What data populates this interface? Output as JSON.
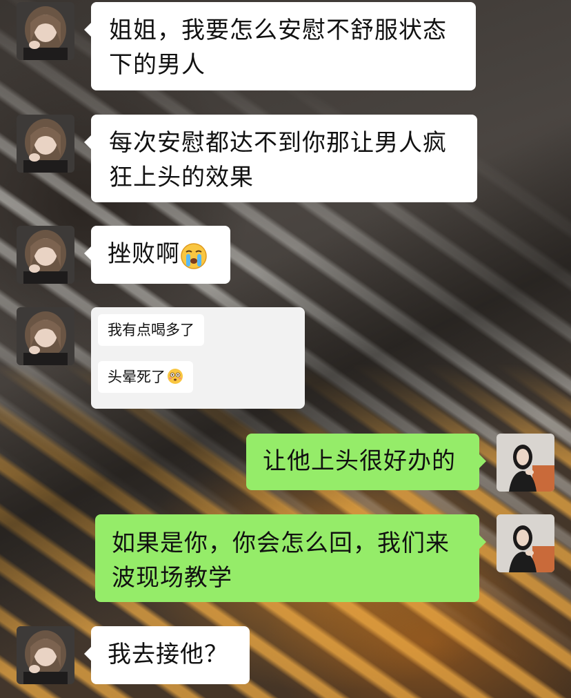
{
  "messages": [
    {
      "side": "left",
      "text": "姐姐，我要怎么安慰不舒服状态\n下的男人"
    },
    {
      "side": "left",
      "text": "每次安慰都达不到你那让男人疯\n狂上头的效果"
    },
    {
      "side": "left",
      "text": "挫败啊",
      "emoji": "crying-face-emoji"
    },
    {
      "side": "left",
      "quoted": [
        "我有点喝多了",
        "头晕死了"
      ],
      "emoji": "flushed-face-emoji"
    },
    {
      "side": "right",
      "text": "让他上头很好办的"
    },
    {
      "side": "right",
      "text": "如果是你，你会怎么回，我们来\n波现场教学"
    },
    {
      "side": "left",
      "text": "我去接他？"
    }
  ],
  "colors": {
    "incoming_bubble": "#ffffff",
    "outgoing_bubble": "#95ec69",
    "quote_card": "#f2f2f2"
  }
}
